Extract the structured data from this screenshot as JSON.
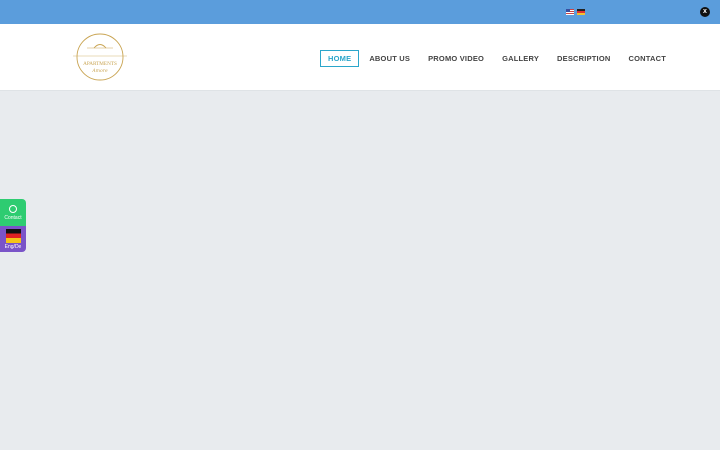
{
  "topbar": {
    "languages": [
      {
        "code": "en",
        "icon": "us-flag-icon"
      },
      {
        "code": "de",
        "icon": "de-flag-icon"
      }
    ],
    "close_label": "x"
  },
  "header": {
    "logo": {
      "line1": "APARTMENTS",
      "line2": "Amore"
    },
    "nav": [
      {
        "label": "HOME",
        "active": true
      },
      {
        "label": "ABOUT US",
        "active": false
      },
      {
        "label": "PROMO VIDEO",
        "active": false
      },
      {
        "label": "GALLERY",
        "active": false
      },
      {
        "label": "DESCRIPTION",
        "active": false
      },
      {
        "label": "CONTACT",
        "active": false
      }
    ]
  },
  "side_widget": {
    "contact_label": "Contact",
    "lang_label": "Eng/De"
  },
  "colors": {
    "topbar": "#5b9ddc",
    "accent": "#2ba6cb",
    "whatsapp_green": "#2ecc71",
    "lang_purple": "#7a54c8",
    "logo_gold": "#c9a452"
  }
}
